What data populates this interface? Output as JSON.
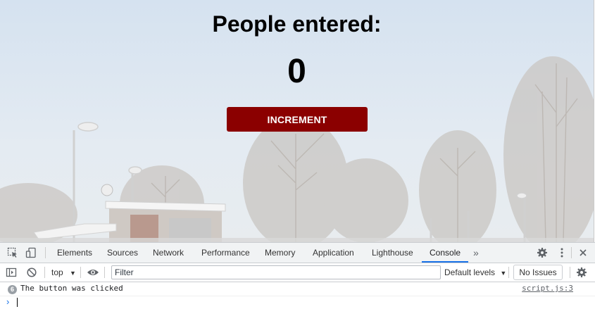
{
  "page": {
    "title": "People entered:",
    "count": "0",
    "button_label": "INCREMENT"
  },
  "devtools": {
    "tabs": [
      "Elements",
      "Sources",
      "Network",
      "Performance",
      "Memory",
      "Application",
      "Lighthouse",
      "Console"
    ],
    "active_tab": "Console",
    "more_tabs_icon": "»",
    "context": "top",
    "filter_placeholder": "Filter",
    "levels": "Default levels",
    "issues": "No Issues",
    "log": {
      "repeat_count": "6",
      "message": "The button was clicked",
      "source": "script.js:3"
    },
    "prompt": "›"
  },
  "colors": {
    "button_bg": "#8b0000",
    "active_tab_underline": "#1a73e8"
  }
}
